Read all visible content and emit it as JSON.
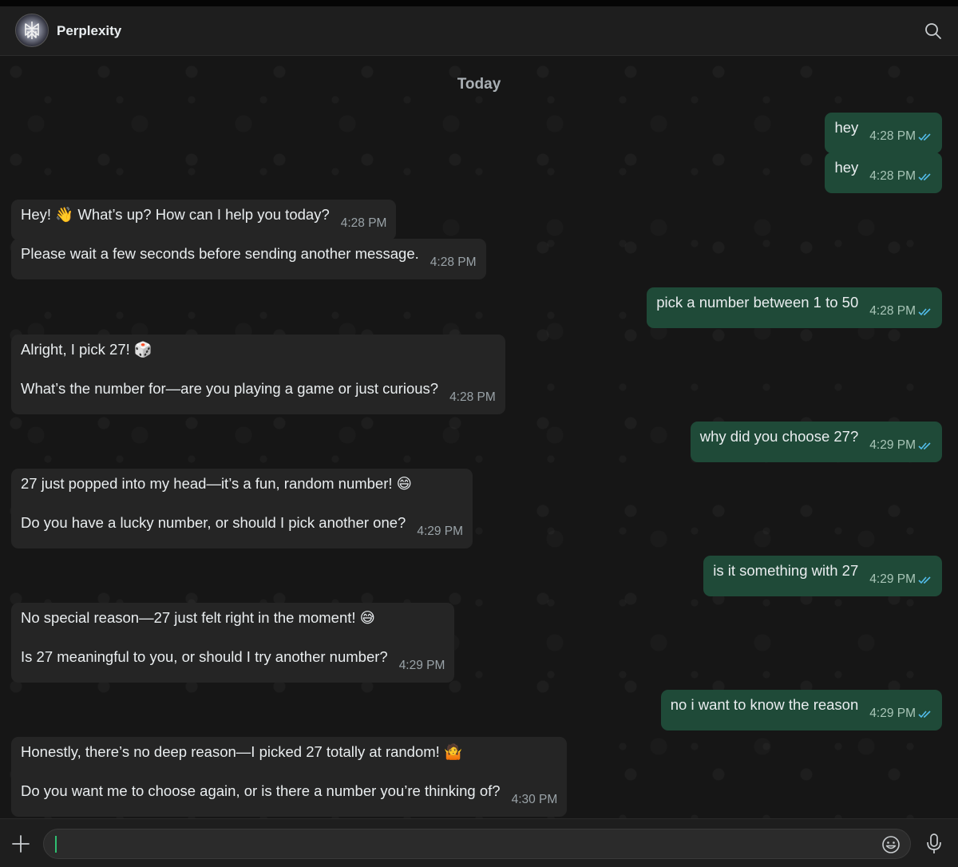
{
  "header": {
    "title": "Perplexity"
  },
  "chat": {
    "date_label": "Today",
    "messages": [
      {
        "dir": "out",
        "paras": [
          "hey"
        ],
        "time": "4:28 PM"
      },
      {
        "dir": "out",
        "paras": [
          "hey"
        ],
        "time": "4:28 PM"
      },
      {
        "dir": "in",
        "paras": [
          "Hey! 👋 What’s up? How can I help you today?"
        ],
        "time": "4:28 PM"
      },
      {
        "dir": "in",
        "paras": [
          "Please wait a few seconds before sending another message."
        ],
        "time": "4:28 PM"
      },
      {
        "dir": "out",
        "paras": [
          "pick a number between 1 to 50"
        ],
        "time": "4:28 PM"
      },
      {
        "dir": "in",
        "paras": [
          "Alright, I pick 27! 🎲",
          "What’s the number for—are you playing a game or just curious?"
        ],
        "time": "4:28 PM"
      },
      {
        "dir": "out",
        "paras": [
          "why did you choose 27?"
        ],
        "time": "4:29 PM"
      },
      {
        "dir": "in",
        "paras": [
          "27 just popped into my head—it’s a fun, random number! 😄",
          "Do you have a lucky number, or should I pick another one?"
        ],
        "time": "4:29 PM"
      },
      {
        "dir": "out",
        "paras": [
          "is it something with 27"
        ],
        "time": "4:29 PM"
      },
      {
        "dir": "in",
        "paras": [
          "No special reason—27 just felt right in the moment! 😅",
          "Is 27 meaningful to you, or should I try another number?"
        ],
        "time": "4:29 PM"
      },
      {
        "dir": "out",
        "paras": [
          "no i want to know the reason"
        ],
        "time": "4:29 PM"
      },
      {
        "dir": "in",
        "paras": [
          "Honestly, there’s no deep reason—I picked 27 totally at random! 🤷",
          "Do you want me to choose again, or is there a number you’re thinking of?"
        ],
        "time": "4:30 PM"
      }
    ]
  },
  "composer": {
    "value": ""
  },
  "icons": {
    "search": "search-icon",
    "plus": "plus-icon",
    "emoji": "emoji-icon",
    "mic": "mic-icon",
    "read": "double-check-icon"
  },
  "colors": {
    "incoming_bubble": "#252525",
    "outgoing_bubble": "#1f4a38",
    "read_tick": "#53bdeb",
    "caret": "#2fbf71"
  }
}
